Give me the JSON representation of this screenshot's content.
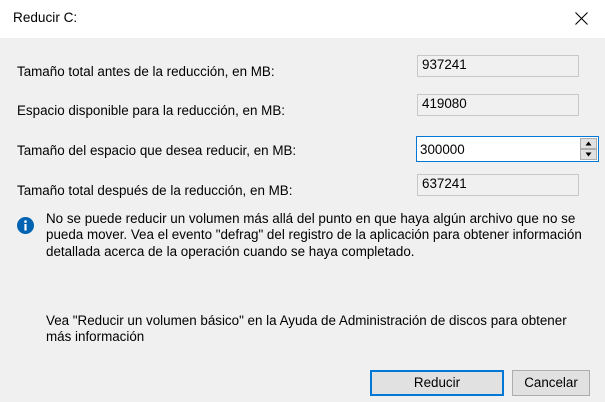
{
  "window": {
    "title": "Reducir C:"
  },
  "fields": [
    {
      "label": "Tamaño total antes de la reducción, en MB:",
      "value": "937241"
    },
    {
      "label": "Espacio disponible para la reducción, en MB:",
      "value": "419080"
    },
    {
      "label": "Tamaño del espacio que desea reducir, en MB:",
      "value": "300000"
    },
    {
      "label": "Tamaño total después de la reducción, en MB:",
      "value": "637241"
    }
  ],
  "info": {
    "icon": "info-icon",
    "text": "No se puede reducir un volumen más allá del punto en que haya algún archivo que no se pueda mover. Vea el evento \"defrag\" del registro de la aplicación para obtener información detallada acerca de la operación cuando se haya completado."
  },
  "help": {
    "text": "Vea \"Reducir un volumen básico\" en la Ayuda de Administración de discos para obtener más información"
  },
  "buttons": {
    "shrink": "Reducir",
    "cancel": "Cancelar"
  },
  "colors": {
    "accent": "#0078d7",
    "info_icon": "#0063b1",
    "dialog_bg": "#f0f0f0"
  }
}
